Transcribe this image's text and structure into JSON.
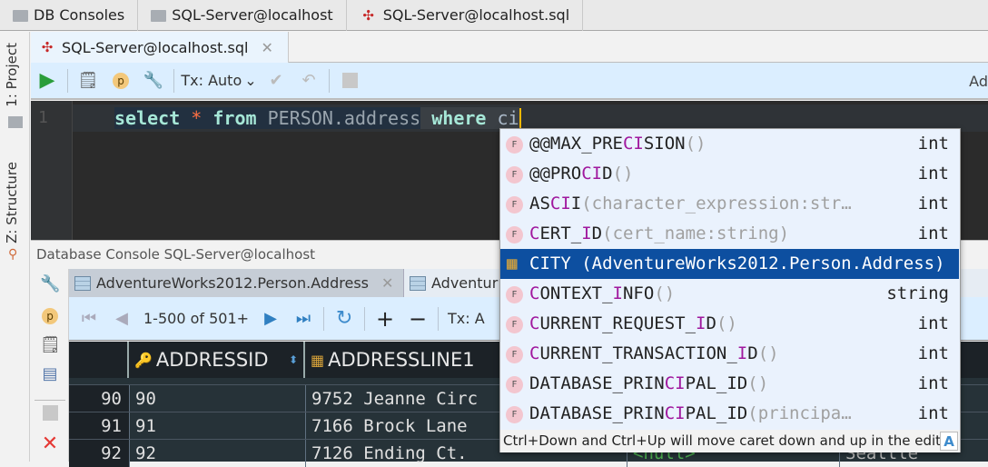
{
  "breadcrumbs": [
    "DB Consoles",
    "SQL-Server@localhost",
    "SQL-Server@localhost.sql"
  ],
  "left_strip": {
    "project": "1: Project",
    "structure": "Z: Structure"
  },
  "editor_tab": {
    "label": "SQL-Server@localhost.sql"
  },
  "editor_toolbar": {
    "tx": "Tx: Auto",
    "right_cut": "Ad"
  },
  "editor": {
    "line_number": "1",
    "code": {
      "kw1": "select",
      "star": "*",
      "kw2": "from",
      "table": "PERSON.address",
      "kw3": "where",
      "typed": "ci"
    }
  },
  "console": {
    "title": "Database Console SQL-Server@localhost",
    "tabs": [
      "AdventureWorks2012.Person.Address",
      "Adventur"
    ],
    "nav": {
      "range": "1-500 of 501+",
      "tx": "Tx: A"
    },
    "columns": [
      "ADDRESSID",
      "ADDRESSLINE1"
    ],
    "rows": [
      {
        "n": "90",
        "id": "90",
        "line1": "9752 Jeanne Circ"
      },
      {
        "n": "91",
        "id": "91",
        "line1": "7166 Brock Lane"
      },
      {
        "n": "92",
        "id": "92",
        "line1": "7126 Ending Ct.",
        "null": "<null>",
        "city": "Seattle"
      }
    ]
  },
  "completion": {
    "items": [
      {
        "icon": "F",
        "parts": [
          [
            "@@MAX_PRE",
            0
          ],
          [
            "CI",
            1
          ],
          [
            "SION",
            0
          ]
        ],
        "params": "()",
        "type": "int"
      },
      {
        "icon": "F",
        "parts": [
          [
            "@@PRO",
            0
          ],
          [
            "CI",
            1
          ],
          [
            "D",
            0
          ]
        ],
        "params": "()",
        "type": "int"
      },
      {
        "icon": "F",
        "parts": [
          [
            "AS",
            0
          ],
          [
            "CI",
            1
          ],
          [
            "I",
            0
          ]
        ],
        "params": "(character_expression:str…",
        "type": "int"
      },
      {
        "icon": "F",
        "parts": [
          [
            "C",
            1
          ],
          [
            "ERT_",
            0
          ],
          [
            "I",
            1
          ],
          [
            "D",
            0
          ]
        ],
        "params": "(cert_name:string)",
        "type": "int"
      },
      {
        "icon": "column",
        "parts": [
          [
            "CITY (AdventureWorks2012.Person.Address)",
            0
          ]
        ],
        "params": "",
        "type": "",
        "selected": true
      },
      {
        "icon": "F",
        "parts": [
          [
            "C",
            1
          ],
          [
            "ONTEXT_",
            0
          ],
          [
            "I",
            1
          ],
          [
            "NFO",
            0
          ]
        ],
        "params": "()",
        "type": "string"
      },
      {
        "icon": "F",
        "parts": [
          [
            "C",
            1
          ],
          [
            "URRENT_REQUEST_",
            0
          ],
          [
            "I",
            1
          ],
          [
            "D",
            0
          ]
        ],
        "params": "()",
        "type": "int"
      },
      {
        "icon": "F",
        "parts": [
          [
            "C",
            1
          ],
          [
            "URRENT_TRANSACTION_",
            0
          ],
          [
            "I",
            1
          ],
          [
            "D",
            0
          ]
        ],
        "params": "()",
        "type": "int"
      },
      {
        "icon": "F",
        "parts": [
          [
            "DATABASE_PRIN",
            0
          ],
          [
            "CI",
            1
          ],
          [
            "PAL_ID",
            0
          ]
        ],
        "params": "()",
        "type": "int"
      },
      {
        "icon": "F",
        "parts": [
          [
            "DATABASE_PRIN",
            0
          ],
          [
            "CI",
            1
          ],
          [
            "PAL_ID",
            0
          ]
        ],
        "params": "(principa…",
        "type": "int"
      }
    ],
    "hint": "Ctrl+Down and Ctrl+Up will move caret down and up in the editor",
    "hint_icon": "A"
  },
  "colors": {
    "selection": "#0d4fa0",
    "match": "#a0189e",
    "toolbar": "#dbeeff"
  }
}
